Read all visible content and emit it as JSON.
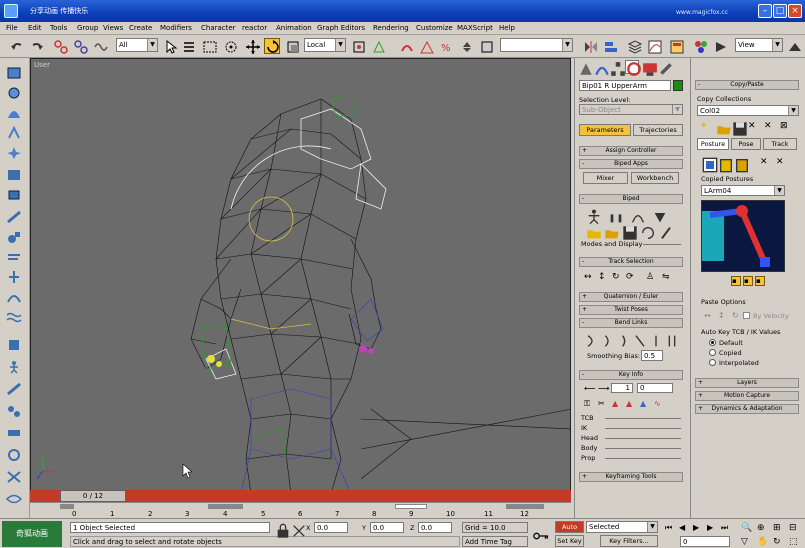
{
  "window": {
    "title": "分享动画 传播快乐",
    "watermark_url": "www.magicfox.cc"
  },
  "menu": [
    "File",
    "Edit",
    "Tools",
    "Group",
    "Views",
    "Create",
    "Modifiers",
    "Character",
    "reactor",
    "Animation",
    "Graph Editors",
    "Rendering",
    "Customize",
    "MAXScript",
    "Help"
  ],
  "toolbar": {
    "selection_filter": "All",
    "coord_system": "Local",
    "named_selection": "",
    "viewport_dropdown": "View"
  },
  "viewport": {
    "label": "User"
  },
  "timeline": {
    "frame_display": "0 / 12",
    "ticks": [
      "0",
      "1",
      "2",
      "3",
      "4",
      "5",
      "6",
      "7",
      "8",
      "9",
      "10",
      "11",
      "12"
    ]
  },
  "status": {
    "selection": "1 Object Selected",
    "prompt": "Click and drag to select and rotate objects",
    "x_label": "X",
    "x_value": "0.0",
    "y_label": "Y",
    "y_value": "0.0",
    "z_label": "Z",
    "z_value": "0.0",
    "grid": "Grid = 10.0",
    "add_time_tag": "Add Time Tag",
    "auto_key": "Auto Key",
    "set_key": "Set Key",
    "key_mode": "Selected",
    "key_filters": "Key Filters...",
    "frame": "0",
    "logo_text": "奇狐动画"
  },
  "command_panel": {
    "object_name": "Bip01 R UpperArm",
    "object_color": "#1a8a1a",
    "selection_level_label": "Selection Level:",
    "sub_object": "Sub-Object",
    "tab_parameters": "Parameters",
    "tab_trajectories": "Trajectories",
    "rollouts": {
      "assign_controller": "Assign Controller",
      "biped_apps": "Biped Apps",
      "biped": "Biped",
      "track_selection": "Track Selection",
      "quaternion_euler": "Quaternion / Euler",
      "twist_poses": "Twist Poses",
      "bend_links": "Bend Links",
      "key_info": "Key Info",
      "keyframing_tools": "Keyframing Tools"
    },
    "mixer": "Mixer",
    "workbench": "Workbench",
    "modes_and_display": "Modes and Display",
    "smoothing_bias_label": "Smoothing Bias:",
    "smoothing_bias": "0.5",
    "key_number": "1",
    "key_time": "0",
    "key_items": [
      "TCB",
      "IK",
      "Head",
      "Body",
      "Prop"
    ]
  },
  "copy_paste": {
    "header": "Copy/Paste",
    "collections_label": "Copy Collections",
    "collection": "Col02",
    "tabs": [
      "Posture",
      "Pose",
      "Track"
    ],
    "copied_postures_label": "Copied Postures",
    "posture": "LArm04",
    "paste_options_label": "Paste Options",
    "by_velocity": "By Velocity",
    "autokey_label": "Auto Key TCB / IK Values",
    "radios": [
      "Default",
      "Copied",
      "Interpolated"
    ],
    "layers": "Layers",
    "motion_capture": "Motion Capture",
    "dynamics": "Dynamics & Adaptation"
  }
}
